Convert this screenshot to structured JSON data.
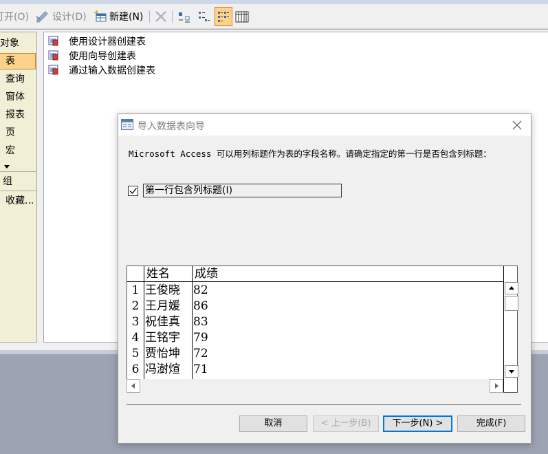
{
  "toolbar": {
    "open_label": "打开(O)",
    "design_label": "设计(D)",
    "new_label": "新建(N)",
    "delete_icon": "close-icon"
  },
  "object_pane": {
    "header": "对象",
    "items": [
      "表",
      "查询",
      "窗体",
      "报表",
      "页",
      "宏"
    ],
    "selected": "表",
    "groups_header": "组",
    "favorites": "收藏..."
  },
  "object_list": {
    "items": [
      "使用设计器创建表",
      "使用向导创建表",
      "通过输入数据创建表"
    ]
  },
  "dialog": {
    "title": "导入数据表向导",
    "description": "Microsoft Access 可以用列标题作为表的字段名称。请确定指定的第一行是否包含列标题：",
    "checkbox_label": "第一行包含列标题(I)",
    "checkbox_checked": true,
    "columns": [
      "姓名",
      "成绩"
    ],
    "rows": [
      {
        "num": "1",
        "name": "王俊晓",
        "score": "82"
      },
      {
        "num": "2",
        "name": "王月媛",
        "score": "86"
      },
      {
        "num": "3",
        "name": "祝佳真",
        "score": "83"
      },
      {
        "num": "4",
        "name": "王铭宇",
        "score": "79"
      },
      {
        "num": "5",
        "name": "贾怡坤",
        "score": "72"
      },
      {
        "num": "6",
        "name": "冯澍煊",
        "score": "71"
      }
    ],
    "buttons": {
      "cancel": "取消",
      "back": "< 上一步(B)",
      "next": "下一步(N) >",
      "finish": "完成(F)"
    }
  },
  "colors": {
    "selected_bg": "#ffd28c",
    "pane_bg": "#f1efd5",
    "default_button_border": "#0078d7"
  }
}
